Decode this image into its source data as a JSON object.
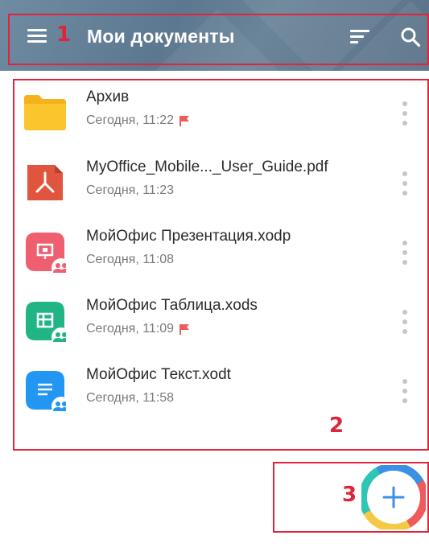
{
  "appbar": {
    "title": "Мои документы",
    "icons": [
      "menu-icon",
      "sort-icon",
      "search-icon"
    ],
    "background": "#5f7b92"
  },
  "files": [
    {
      "name": "Архив",
      "modified": "Сегодня, 11:22",
      "flagged": true,
      "type": "folder",
      "icon": "folder-icon",
      "color": "#fbc02d"
    },
    {
      "name": "MyOffice_Mobile..._User_Guide.pdf",
      "modified": "Сегодня, 11:23",
      "flagged": false,
      "type": "pdf",
      "icon": "pdf-icon",
      "color": "#e1553f"
    },
    {
      "name": "МойОфис Презентация.xodp",
      "modified": "Сегодня, 11:08",
      "flagged": false,
      "type": "presentation",
      "icon": "presentation-icon",
      "color": "#ef5f6f",
      "shared": true
    },
    {
      "name": "МойОфис Таблица.xods",
      "modified": "Сегодня, 11:09",
      "flagged": true,
      "type": "spreadsheet",
      "icon": "spreadsheet-icon",
      "color": "#21b585",
      "shared": true
    },
    {
      "name": "МойОфис Текст.xodt",
      "modified": "Сегодня, 11:58",
      "flagged": false,
      "type": "text",
      "icon": "text-document-icon",
      "color": "#2196f3",
      "shared": true
    }
  ],
  "annotations": {
    "label_1": "1",
    "label_2": "2",
    "label_3": "3",
    "color": "#e0243a"
  },
  "fab": {
    "icon": "plus-icon",
    "colors": [
      "#2ec4b6",
      "#f6c945",
      "#ef5a5a",
      "#3a8fe6"
    ]
  }
}
